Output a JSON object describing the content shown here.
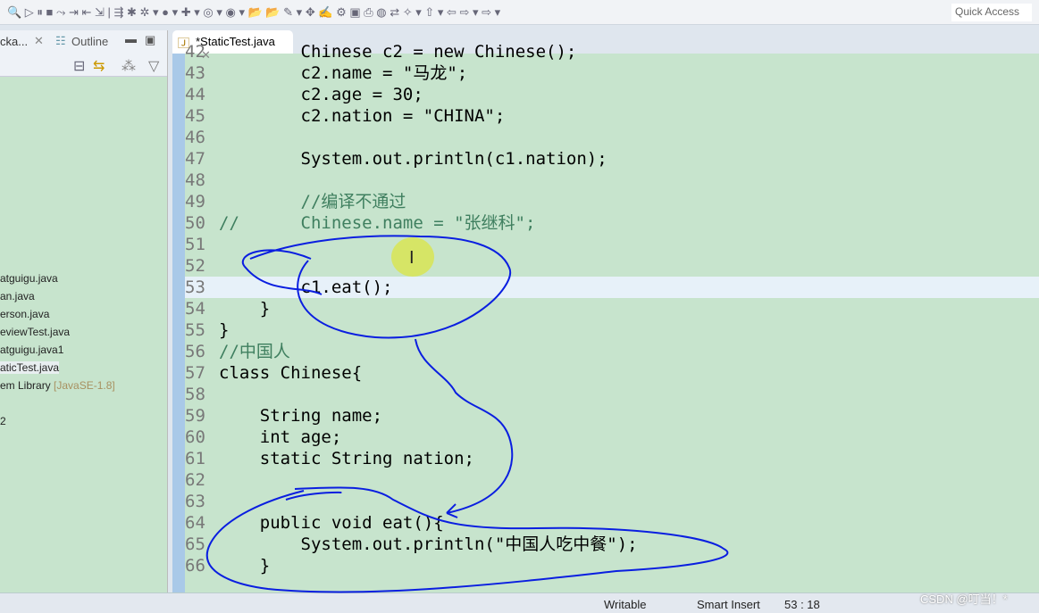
{
  "toolbar": {
    "quick_access": "Quick Access"
  },
  "left_panel": {
    "tab_package": "cka...",
    "tab_outline": "Outline",
    "items": [
      "atguigu.java",
      "an.java",
      "erson.java",
      "eviewTest.java",
      "atguigu.java1",
      "aticTest.java",
      "em Library"
    ],
    "library_tag": "[JavaSE-1.8]",
    "extra": "2"
  },
  "editor": {
    "tab_title": "*StaticTest.java",
    "lines": [
      {
        "n": "42",
        "t": "        Chinese c2 = new Chinese();"
      },
      {
        "n": "43",
        "t": "        c2.name = \"马龙\";"
      },
      {
        "n": "44",
        "t": "        c2.age = 30;"
      },
      {
        "n": "45",
        "t": "        c2.nation = \"CHINA\";"
      },
      {
        "n": "46",
        "t": ""
      },
      {
        "n": "47",
        "t": "        System.out.println(c1.nation);"
      },
      {
        "n": "48",
        "t": ""
      },
      {
        "n": "49",
        "t": "        //编译不通过"
      },
      {
        "n": "50",
        "t": "//      Chinese.name = \"张继科\";"
      },
      {
        "n": "51",
        "t": ""
      },
      {
        "n": "52",
        "t": ""
      },
      {
        "n": "53",
        "t": "        c1.eat();"
      },
      {
        "n": "54",
        "t": "    }"
      },
      {
        "n": "55",
        "t": "}"
      },
      {
        "n": "56",
        "t": "//中国人"
      },
      {
        "n": "57",
        "t": "class Chinese{"
      },
      {
        "n": "58",
        "t": ""
      },
      {
        "n": "59",
        "t": "    String name;"
      },
      {
        "n": "60",
        "t": "    int age;"
      },
      {
        "n": "61",
        "t": "    static String nation;"
      },
      {
        "n": "62",
        "t": ""
      },
      {
        "n": "63",
        "t": ""
      },
      {
        "n": "64",
        "t": "    public void eat(){"
      },
      {
        "n": "65",
        "t": "        System.out.println(\"中国人吃中餐\");"
      },
      {
        "n": "66",
        "t": "    }"
      }
    ]
  },
  "status": {
    "writable": "Writable",
    "insert_mode": "Smart Insert",
    "position": "53 : 18",
    "watermark": "CSDN @叮当！*"
  },
  "colors": {
    "editor_bg": "#c7e4cd",
    "annotation": "#0a1ee0",
    "keyword": "#7f0055",
    "string": "#2a00ff"
  }
}
